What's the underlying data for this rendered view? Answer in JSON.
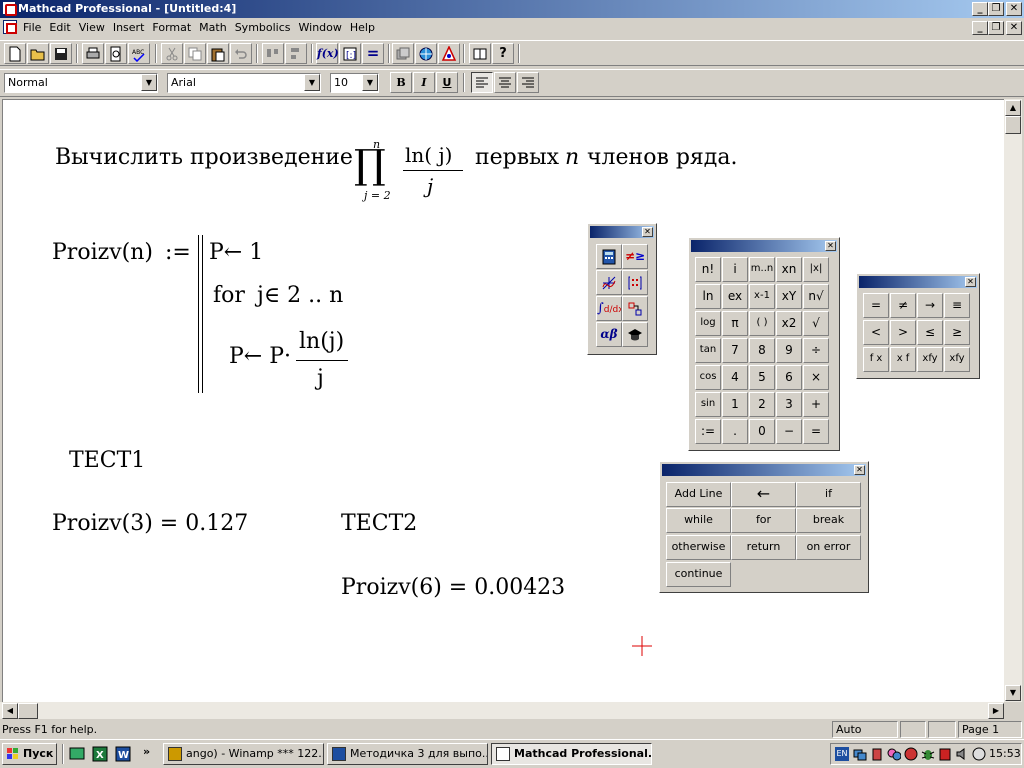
{
  "window": {
    "title": "Mathcad Professional - [Untitled:4]"
  },
  "menu": [
    "File",
    "Edit",
    "View",
    "Insert",
    "Format",
    "Math",
    "Symbolics",
    "Window",
    "Help"
  ],
  "format_bar": {
    "style": "Normal",
    "font": "Arial",
    "size": "10",
    "bold": "B",
    "italic": "I",
    "underline": "U"
  },
  "document": {
    "heading_before": "Вычислить произведение",
    "product_upper": "n",
    "product_lower": "j = 2",
    "product_num": "ln( j)",
    "product_den": "j",
    "heading_after_1": "первых",
    "heading_n": "n",
    "heading_after_2": "членов ряда.",
    "func_def": "Proizv(n)",
    "assign": ":=",
    "prog_line1": "P← 1",
    "for_kw": "for",
    "for_range": "j∈  2 .. n",
    "prog_line3_lhs": "P← P·",
    "prog_frac_num": "ln(j)",
    "prog_frac_den": "j",
    "test1": "TECT1",
    "eval1": "Proizv(3)  =  0.127",
    "test2": "TECT2",
    "eval2": "Proizv(6)  =  0.00423"
  },
  "calc_palette": {
    "rows": [
      [
        "n!",
        "i",
        "m..n",
        "xn",
        "|x|"
      ],
      [
        "ln",
        "ex",
        "x-1",
        "xY",
        "n√"
      ],
      [
        "log",
        "π",
        "( )",
        "x2",
        "√"
      ],
      [
        "tan",
        "7",
        "8",
        "9",
        "÷"
      ],
      [
        "cos",
        "4",
        "5",
        "6",
        "×"
      ],
      [
        "sin",
        "1",
        "2",
        "3",
        "+"
      ],
      [
        ":=",
        ".",
        "0",
        "−",
        "="
      ]
    ]
  },
  "bool_palette": {
    "rows": [
      [
        "=",
        "≠",
        "→",
        "≡"
      ],
      [
        "<",
        ">",
        "≤",
        "≥"
      ],
      [
        "f x",
        "x f",
        "xfy",
        "xfy"
      ]
    ]
  },
  "prog_palette": {
    "buttons": [
      "Add Line",
      "←",
      "if",
      "while",
      "for",
      "break",
      "otherwise",
      "return",
      "on error",
      "continue"
    ]
  },
  "status": {
    "help": "Press F1 for help.",
    "mode": "Auto",
    "page": "Page 1"
  },
  "taskbar": {
    "start": "Пуск",
    "tasks": [
      "ango) - Winamp *** 122...",
      "Методичка 3 для выпо...",
      "Mathcad Professional..."
    ],
    "tray_lang": "EN",
    "clock": "15:53"
  }
}
